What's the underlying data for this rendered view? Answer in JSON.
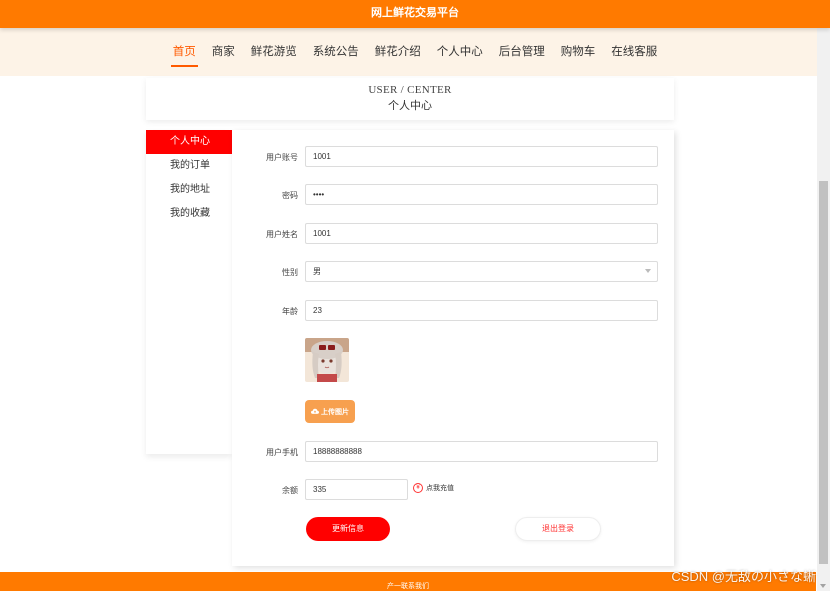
{
  "site_title": "网上鲜花交易平台",
  "nav": {
    "items": [
      "首页",
      "商家",
      "鲜花游览",
      "系统公告",
      "鲜花介绍",
      "个人中心",
      "后台管理",
      "购物车",
      "在线客服"
    ]
  },
  "header": {
    "en": "USER / CENTER",
    "cn": "个人中心"
  },
  "sidebar": {
    "items": [
      "个人中心",
      "我的订单",
      "我的地址",
      "我的收藏"
    ]
  },
  "form": {
    "account": {
      "label": "用户账号",
      "value": "1001"
    },
    "password": {
      "label": "密码",
      "value": "••••"
    },
    "name": {
      "label": "用户姓名",
      "value": "1001"
    },
    "gender": {
      "label": "性别",
      "value": "男"
    },
    "age": {
      "label": "年龄",
      "value": "23"
    },
    "upload_label": "上传图片",
    "phone": {
      "label": "用户手机",
      "value": "18888888888"
    },
    "balance": {
      "label": "余额",
      "value": "335"
    },
    "recharge_label": "点我充值",
    "update_label": "更新信息",
    "logout_label": "退出登录"
  },
  "footer": {
    "text": "产一联系我们"
  },
  "watermark": "CSDN @无敌の小さな蜥",
  "colors": {
    "brand_orange": "#ff7a00",
    "accent_red": "#ff0000",
    "nav_bg": "#fdf3e7"
  },
  "icons": {
    "upload": "cloud-upload-icon",
    "recharge": "recharge-icon"
  }
}
